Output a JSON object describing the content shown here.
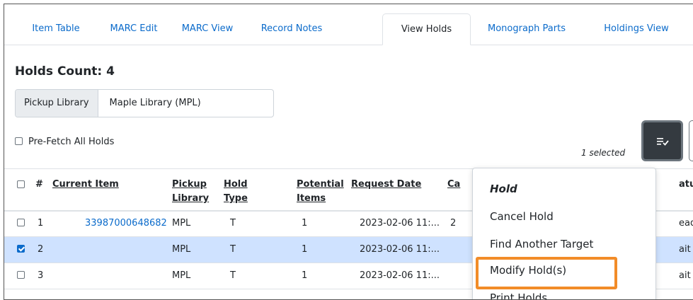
{
  "tabs": [
    {
      "label": "Item Table"
    },
    {
      "label": "MARC Edit"
    },
    {
      "label": "MARC View"
    },
    {
      "label": "Record Notes"
    },
    {
      "label": "View Holds",
      "active": true
    },
    {
      "label": "Monograph Parts"
    },
    {
      "label": "Holdings View"
    }
  ],
  "holds_count_title": "Holds Count: 4",
  "pickup": {
    "label": "Pickup Library",
    "value": "Maple Library (MPL)"
  },
  "prefetch_label": "Pre-Fetch All Holds",
  "selected_count": "1 selected",
  "actions_icon": "list-check-icon",
  "table": {
    "headers": {
      "hash": "#",
      "current_item": "Current Item",
      "pickup_1": "Pickup",
      "pickup_2": "Library",
      "hold_1": "Hold",
      "hold_2": "Type",
      "potential_1": "Potential",
      "potential_2": "Items",
      "request_date": "Request Date",
      "c": "Ca",
      "status": "atu"
    },
    "rows": [
      {
        "num": "1",
        "current_item": "33987000648682",
        "pickup": "MPL",
        "hold_type": "T",
        "potential": "1",
        "request_date": "2023-02-06 11:...",
        "c": "2",
        "status": "ead",
        "checked": false
      },
      {
        "num": "2",
        "current_item": "",
        "pickup": "MPL",
        "hold_type": "T",
        "potential": "1",
        "request_date": "2023-02-06 11:...",
        "c": "",
        "status": "ait",
        "checked": true
      },
      {
        "num": "3",
        "current_item": "",
        "pickup": "MPL",
        "hold_type": "T",
        "potential": "1",
        "request_date": "2023-02-06 11:...",
        "c": "",
        "status": "ait",
        "checked": false
      }
    ]
  },
  "menu": {
    "header": "Hold",
    "items": [
      "Cancel Hold",
      "Find Another Target",
      "Modify Hold(s)",
      "Print Holds"
    ]
  },
  "colors": {
    "link": "#0b6bcb",
    "selected_row": "#cfe2ff",
    "highlight": "#f28c28",
    "dark_button": "#343a40"
  }
}
